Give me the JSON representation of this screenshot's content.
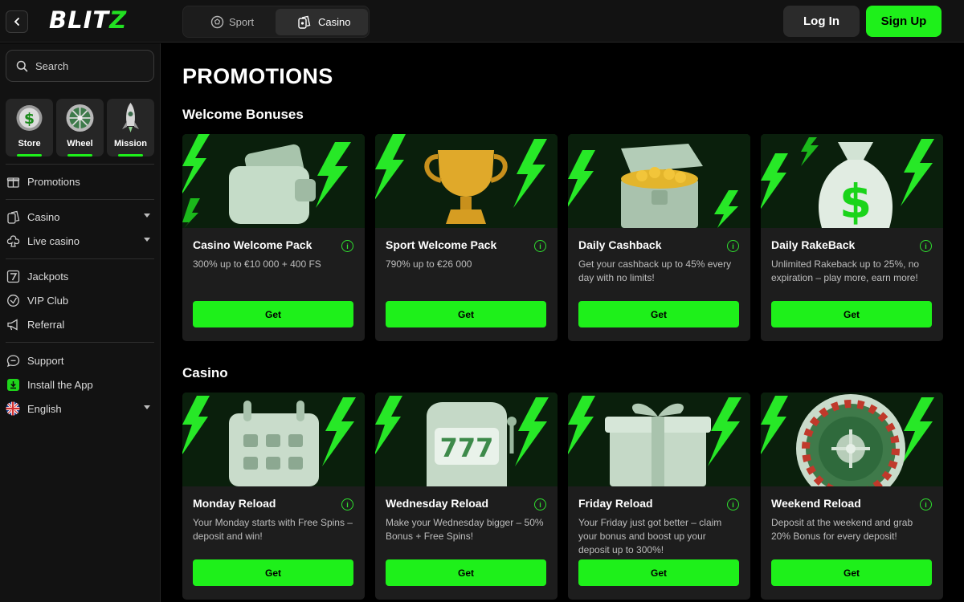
{
  "header": {
    "logo": "BLIT",
    "logo_accent": "Z",
    "tabs": [
      {
        "label": "Sport",
        "icon": "soccer-ball-icon"
      },
      {
        "label": "Casino",
        "icon": "cards-icon"
      }
    ],
    "login_label": "Log In",
    "signup_label": "Sign Up"
  },
  "sidebar": {
    "search_placeholder": "Search",
    "quick_links": [
      {
        "label": "Store",
        "icon": "coin-icon"
      },
      {
        "label": "Wheel",
        "icon": "wheel-icon"
      },
      {
        "label": "Mission",
        "icon": "rocket-icon"
      }
    ],
    "items": [
      {
        "label": "Promotions",
        "icon": "gift-icon"
      },
      {
        "label": "Casino",
        "icon": "cards-icon"
      },
      {
        "label": "Live casino",
        "icon": "club-icon"
      },
      {
        "label": "Jackpots",
        "icon": "seven-icon"
      },
      {
        "label": "VIP Club",
        "icon": "vip-icon"
      },
      {
        "label": "Referral",
        "icon": "megaphone-icon"
      },
      {
        "label": "Support",
        "icon": "chat-icon"
      },
      {
        "label": "Install the App",
        "icon": "download-icon"
      },
      {
        "label": "English",
        "icon": "uk-flag-icon"
      }
    ]
  },
  "main": {
    "page_title": "PROMOTIONS",
    "sections": [
      {
        "title": "Welcome Bonuses",
        "cards": [
          {
            "title": "Casino Welcome Pack",
            "desc": "300% up to €10 000 + 400 FS",
            "button": "Get",
            "image": "wallet-icon"
          },
          {
            "title": "Sport Welcome Pack",
            "desc": "790% up to €26 000",
            "button": "Get",
            "image": "trophy-icon"
          },
          {
            "title": "Daily Cashback",
            "desc": "Get your cashback up to 45% every day with no limits!",
            "button": "Get",
            "image": "treasure-chest-icon"
          },
          {
            "title": "Daily RakeBack",
            "desc": "Unlimited Rakeback up to 25%, no expiration – play more, earn more!",
            "button": "Get",
            "image": "money-bag-icon"
          }
        ]
      },
      {
        "title": "Casino",
        "cards": [
          {
            "title": "Monday Reload",
            "desc": "Your Monday starts with Free Spins – deposit and win!",
            "button": "Get",
            "image": "calendar-icon"
          },
          {
            "title": "Wednesday Reload",
            "desc": "Make your Wednesday bigger – 50% Bonus + Free Spins!",
            "button": "Get",
            "image": "slot-machine-icon"
          },
          {
            "title": "Friday Reload",
            "desc": "Your Friday just got better – claim your bonus and boost up your deposit up to 300%!",
            "button": "Get",
            "image": "gift-box-icon"
          },
          {
            "title": "Weekend Reload",
            "desc": "Deposit at the weekend and grab 20% Bonus for every deposit!",
            "button": "Get",
            "image": "roulette-icon"
          }
        ]
      }
    ]
  }
}
